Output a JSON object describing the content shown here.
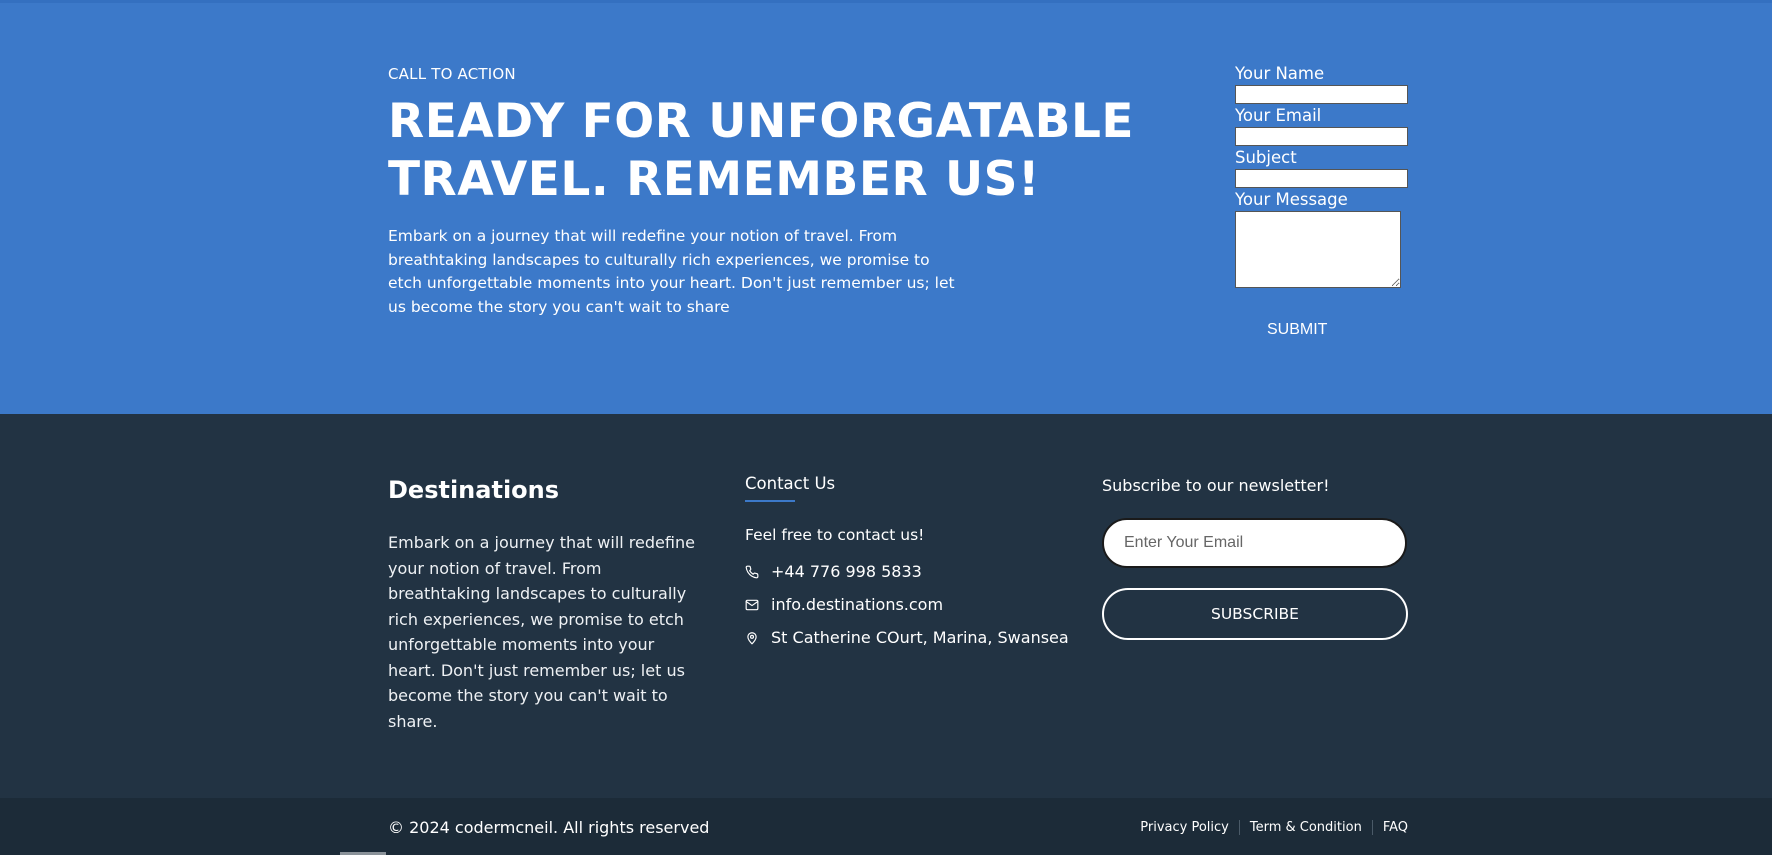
{
  "cta": {
    "eyebrow": "CALL TO ACTION",
    "title": "READY FOR UNFORGATABLE TRAVEL. REMEMBER US!",
    "text": "Embark on a journey that will redefine your notion of travel. From breathtaking landscapes to culturally rich experiences, we promise to etch unforgettable moments into your heart. Don't just remember us; let us become the story you can't wait to share"
  },
  "form": {
    "name_label": "Your Name",
    "name_value": "",
    "email_label": "Your Email",
    "email_value": "",
    "subject_label": "Subject",
    "subject_value": "",
    "message_label": "Your Message",
    "message_value": "",
    "submit_label": "SUBMIT"
  },
  "footer": {
    "brand": "Destinations",
    "brand_text": "Embark on a journey that will redefine your notion of travel. From breathtaking landscapes to culturally rich experiences, we promise to etch unforgettable moments into your heart. Don't just remember us; let us become the story you can't wait to share.",
    "contact": {
      "title": "Contact Us",
      "intro": "Feel free to contact us!",
      "phone": "+44 776 998 5833",
      "email": "info.destinations.com",
      "address": "St Catherine COurt, Marina, Swansea",
      "phone_icon": "phone-icon",
      "email_icon": "envelope-icon",
      "address_icon": "map-pin-icon"
    },
    "newsletter": {
      "title": "Subscribe to our newsletter!",
      "placeholder": "Enter Your Email",
      "value": "",
      "button": "SUBSCRIBE"
    }
  },
  "bottom": {
    "copyright": "© 2024 codermcneil. All rights reserved",
    "links": [
      "Privacy Policy",
      "Term & Condition",
      "FAQ"
    ]
  },
  "colors": {
    "cta_bg": "#3c79c9",
    "footer_bg": "#223343",
    "bottom_bg": "#1c2b38",
    "accent": "#3c79c9"
  }
}
